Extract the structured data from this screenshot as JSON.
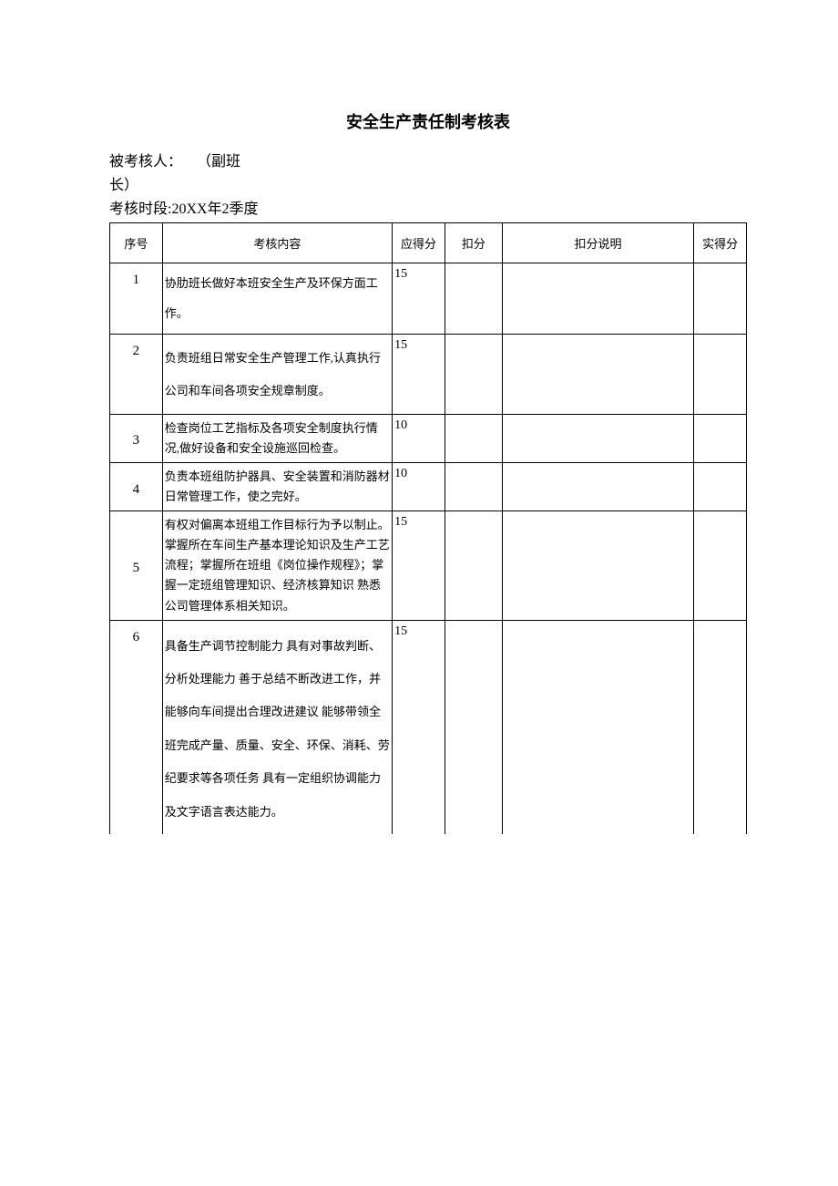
{
  "title": "安全生产责任制考核表",
  "meta": {
    "line1": "被考核人：　　（副班",
    "line2": "长）",
    "line3": "考核时段:20XX年2季度"
  },
  "headers": {
    "num": "序号",
    "content": "考核内容",
    "score": "应得分",
    "deduct": "扣分",
    "reason": "扣分说明",
    "actual": "实得分"
  },
  "rows": [
    {
      "num": "1",
      "content": "协肋班长做好本班安全生产及环保方面工作。",
      "score": "15"
    },
    {
      "num": "2",
      "content": "负责班组日常安全生产管理工作,认真执行公司和车间各项安全规章制度。",
      "score": "15"
    },
    {
      "num": "3",
      "content": "检查岗位工艺指标及各项安全制度执行情况,做好设备和安全设施巡回检查。",
      "score": "10"
    },
    {
      "num": "4",
      "content": "负责本班组防护器具、安全装置和消防器材日常管理工作，使之完好。",
      "score": "10"
    },
    {
      "num": "5",
      "content": "有权对偏离本班组工作目标行为予以制止。掌握所在车间生产基本理论知识及生产工艺流程；掌握所在班组《岗位操作规程》；掌握一定班组管理知识、经济核算知识 熟悉公司管理体系相关知识。",
      "score": "15"
    },
    {
      "num": "6",
      "content": "具备生产调节控制能力 具有对事故判断、分析处理能力 善于总结不断改进工作，并能够向车间提出合理改进建议 能够带领全班完成产量、质量、安全、环保、消耗、劳纪要求等各项任务 具有一定组织协调能力及文字语言表达能力。",
      "score": "15"
    }
  ]
}
